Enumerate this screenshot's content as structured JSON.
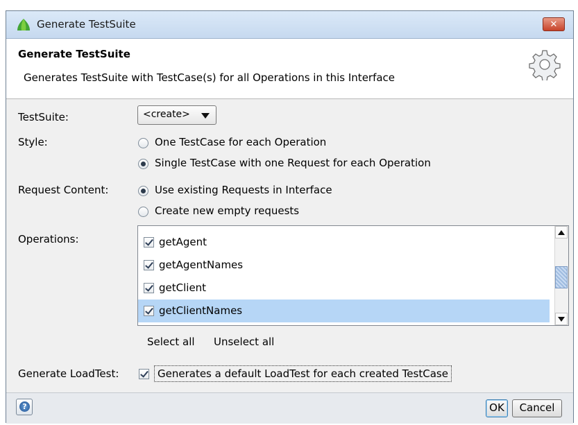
{
  "window": {
    "title": "Generate TestSuite",
    "close_symbol": "✕"
  },
  "header": {
    "title": "Generate TestSuite",
    "description": "Generates TestSuite with TestCase(s) for all Operations in this Interface",
    "icon": "gear-icon"
  },
  "form": {
    "testsuite_label": "TestSuite:",
    "testsuite_value": "<create>",
    "style_label": "Style:",
    "style_options": [
      {
        "label": "One TestCase for each Operation",
        "selected": false
      },
      {
        "label": "Single TestCase with one Request for each Operation",
        "selected": true
      }
    ],
    "request_content_label": "Request Content:",
    "request_options": [
      {
        "label": "Use existing Requests in Interface",
        "selected": true
      },
      {
        "label": "Create new empty requests",
        "selected": false
      }
    ],
    "operations_label": "Operations:",
    "operations": [
      {
        "label": "getAgent",
        "checked": true,
        "selected": false
      },
      {
        "label": "getAgentNames",
        "checked": true,
        "selected": false
      },
      {
        "label": "getClient",
        "checked": true,
        "selected": false
      },
      {
        "label": "getClientNames",
        "checked": true,
        "selected": true
      }
    ],
    "select_all": "Select all",
    "unselect_all": "Unselect all",
    "loadtest_label": "Generate LoadTest:",
    "loadtest_checked": true,
    "loadtest_description": "Generates a default LoadTest for each created TestCase"
  },
  "footer": {
    "help_symbol": "?",
    "ok_label": "OK",
    "cancel_label": "Cancel"
  }
}
